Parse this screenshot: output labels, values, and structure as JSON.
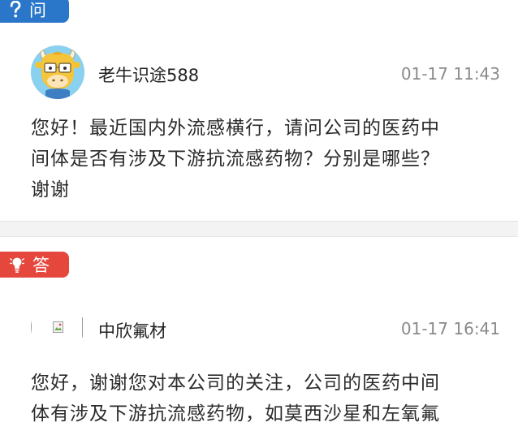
{
  "question": {
    "tag_label": "问",
    "tag_icon": "question-mark-icon",
    "tag_color": "#2a77c9",
    "avatar_icon": "cow-cartoon-avatar",
    "username": "老牛识途588",
    "timestamp": "01-17 11:43",
    "body": "您好！最近国内外流感横行，请问公司的医药中\n间体是否有涉及下游抗流感药物？分别是哪些？\n谢谢"
  },
  "answer": {
    "tag_label": "答",
    "tag_icon": "lightbulb-icon",
    "tag_color": "#e5473d",
    "avatar_icon": "broken-image-icon",
    "username": "中欣氟材",
    "timestamp": "01-17 16:41",
    "body": "您好，谢谢您对本公司的关注，公司的医药中间\n体有涉及下游抗流感药物，如莫西沙星和左氧氟"
  }
}
